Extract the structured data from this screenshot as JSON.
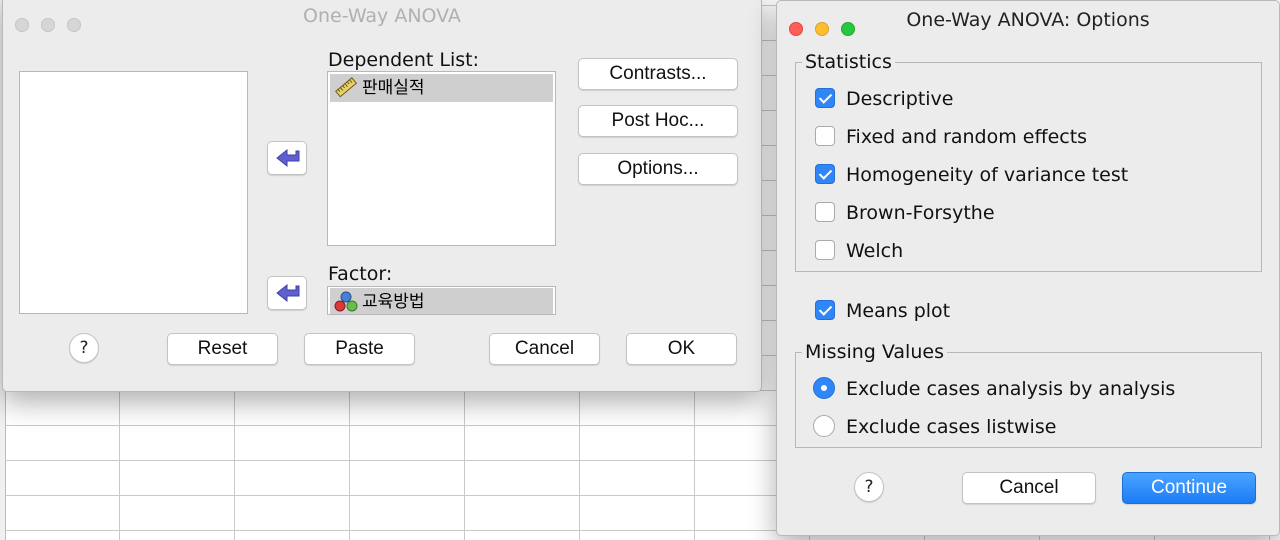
{
  "main_dialog": {
    "title": "One-Way ANOVA",
    "dependent_list": {
      "label": "Dependent List:",
      "items": [
        {
          "label": "판매실적",
          "icon": "scale-ruler-icon"
        }
      ]
    },
    "factor": {
      "label": "Factor:",
      "item": {
        "label": "교육방법",
        "icon": "nominal-balls-icon"
      }
    },
    "buttons": {
      "contrasts": "Contrasts...",
      "post_hoc": "Post Hoc...",
      "options": "Options...",
      "help": "?",
      "reset": "Reset",
      "paste": "Paste",
      "cancel": "Cancel",
      "ok": "OK"
    }
  },
  "options_dialog": {
    "title": "One-Way ANOVA: Options",
    "statistics": {
      "title": "Statistics",
      "options": [
        {
          "label": "Descriptive",
          "checked": true
        },
        {
          "label": "Fixed and random effects",
          "checked": false
        },
        {
          "label": "Homogeneity of variance test",
          "checked": true
        },
        {
          "label": "Brown-Forsythe",
          "checked": false
        },
        {
          "label": "Welch",
          "checked": false
        }
      ]
    },
    "means_plot": {
      "label": "Means plot",
      "checked": true
    },
    "missing_values": {
      "title": "Missing Values",
      "options": [
        {
          "label": "Exclude cases analysis by analysis",
          "selected": true
        },
        {
          "label": "Exclude cases listwise",
          "selected": false
        }
      ]
    },
    "buttons": {
      "help": "?",
      "cancel": "Cancel",
      "continue": "Continue"
    }
  },
  "colors": {
    "accent": "#2f86f6",
    "primary_button": "#1c7cf4",
    "dialog_bg": "#ececec",
    "selection": "#cfcfcf"
  }
}
